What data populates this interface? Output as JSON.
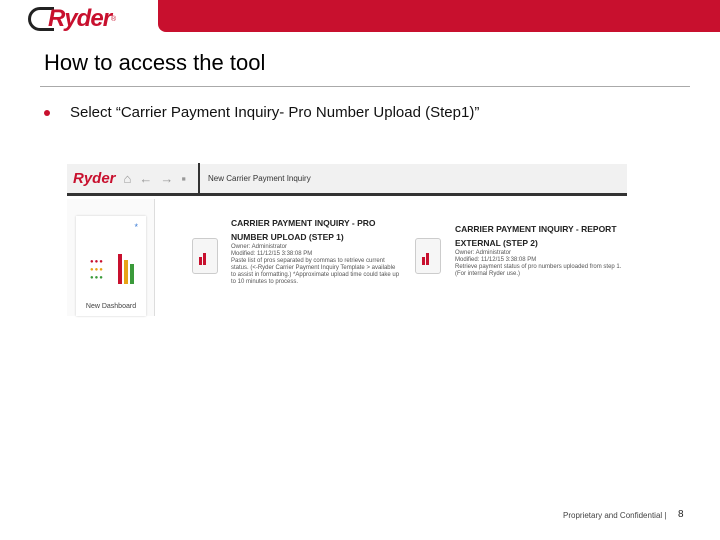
{
  "header": {
    "logo": "Ryder"
  },
  "slide": {
    "title": "How to access the tool",
    "bullet": "Select “Carrier Payment Inquiry- Pro Number Upload (Step1)”"
  },
  "screenshot": {
    "logo": "Ryder",
    "breadcrumb": "New Carrier Payment Inquiry",
    "dashboard_label": "New Dashboard",
    "items": [
      {
        "title": "CARRIER PAYMENT INQUIRY - PRO NUMBER UPLOAD (STEP 1)",
        "owner": "Owner: Administrator",
        "modified": "Modified: 11/12/15 3:38:08 PM",
        "desc": "Paste list of pros separated by commas to retrieve current status. (<-Ryder Carrier Payment Inquiry Template > available to assist in formatting.) *Approximate upload time could take up to 10 minutes to process."
      },
      {
        "title": "CARRIER PAYMENT INQUIRY - REPORT EXTERNAL (STEP 2)",
        "owner": "Owner: Administrator",
        "modified": "Modified: 11/12/15 3:38:08 PM",
        "desc": "Retrieve payment status of pro numbers uploaded from step 1. (For internal Ryder use.)"
      }
    ]
  },
  "footer": {
    "text": "Proprietary and Confidential |",
    "page": "8"
  },
  "colors": {
    "brand": "#c8102e"
  }
}
